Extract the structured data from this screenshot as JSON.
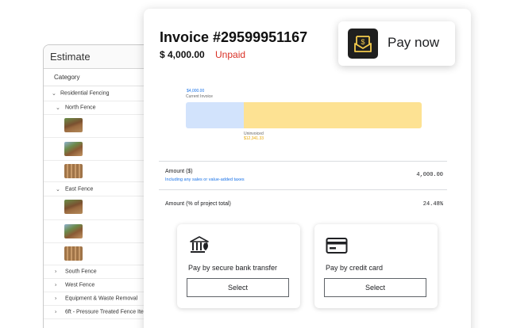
{
  "estimate": {
    "title": "Estimate",
    "category_header": "Category",
    "group": "Residential Fencing",
    "sub1": "North Fence",
    "sub2": "East Fence",
    "collapsed": [
      "South Fence",
      "West Fence",
      "Equipment & Waste Removal",
      "6ft - Pressure Treated Fence Ite"
    ]
  },
  "invoice": {
    "title": "Invoice #29599951167",
    "amount": "$ 4,000.00",
    "status": "Unpaid",
    "current_value": "$4,000.00",
    "current_label": "Current Invoice",
    "current_fraction": 0.2448,
    "uninvoiced_label": "Uninvoiced",
    "uninvoiced_value": "$12,341.33",
    "amount_label": "Amount ($)",
    "amount_sub": "Including any sales or value-added taxes",
    "amount_value": "4,000.00",
    "percent_label": "Amount (% of project total)",
    "percent_value": "24.48%"
  },
  "payment": {
    "bank_label": "Pay by secure bank transfer",
    "card_label": "Pay by credit card",
    "select_label": "Select"
  },
  "paynow": {
    "label": "Pay now",
    "icon": "payment-download-icon"
  },
  "colors": {
    "unpaid": "#d93025",
    "current": "#d2e3fc",
    "uninvoiced": "#fde293",
    "link": "#1a73e8"
  }
}
